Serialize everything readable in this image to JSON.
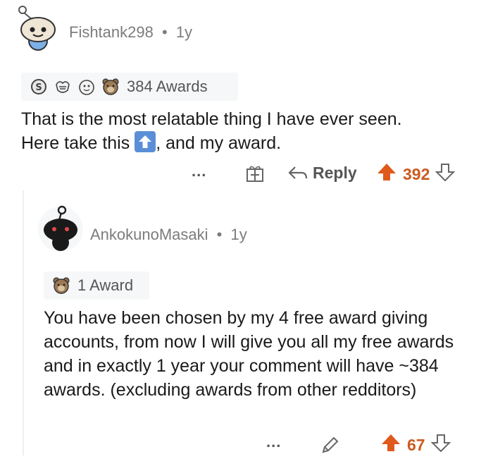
{
  "comment1": {
    "username": "Fishtank298",
    "separator": "•",
    "age": "1y",
    "awards_label": "384 Awards",
    "award_icons": [
      "silver-award-icon",
      "wholesome-award-icon",
      "helpful-award-icon",
      "bear-award-icon"
    ],
    "body_part1": "That is the most relatable thing I have ever seen.",
    "body_part2": "Here take this",
    "body_part3": ", and my award.",
    "more_label": "...",
    "reply_label": "Reply",
    "score": "392"
  },
  "comment2": {
    "username": "AnkokunoMasaki",
    "separator": "•",
    "age": "1y",
    "awards_label": "1 Award",
    "award_icons": [
      "bear-award-icon"
    ],
    "body": "You have been chosen by my 4 free award giving accounts, from now I will give you all my free awards and in exactly 1 year your comment will have ~384 awards. (excluding awards from other redditors)",
    "more_label": "...",
    "score": "67"
  },
  "colors": {
    "upvote": "#cc5a1f",
    "upvote_icon": "#e0591c",
    "muted": "#7c7c7c",
    "award_bg": "#f6f7f8",
    "inline_upvote_bg": "#5a8fd8"
  }
}
